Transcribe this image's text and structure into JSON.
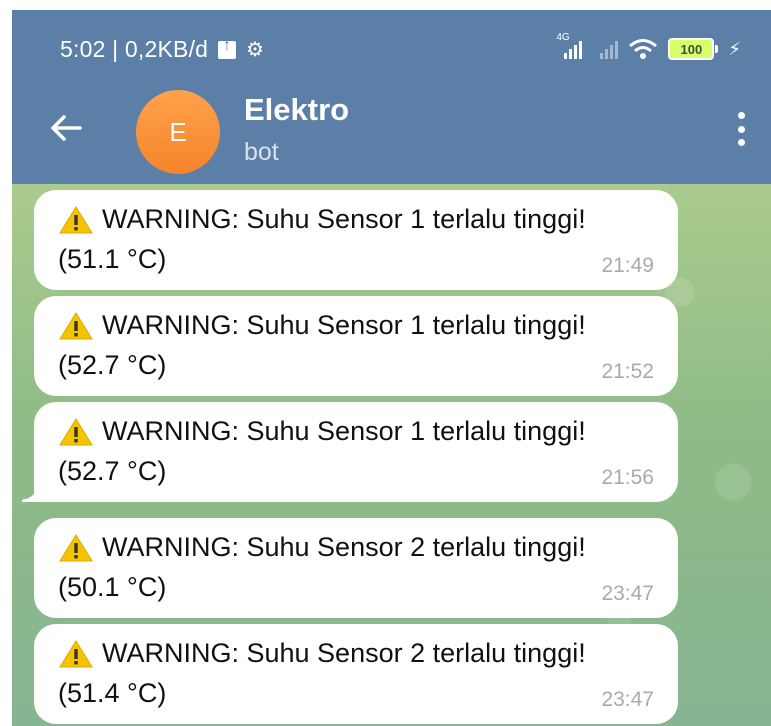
{
  "statusbar": {
    "time_speed": "5:02 | 0,2KB/d",
    "network_label": "4G",
    "battery": "100"
  },
  "header": {
    "title": "Elektro",
    "subtitle": "bot",
    "avatar_letter": "E"
  },
  "messages": [
    {
      "text": "WARNING: Suhu Sensor 1 terlalu tinggi!",
      "value": "(51.1 °C)",
      "time": "21:49"
    },
    {
      "text": "WARNING: Suhu Sensor 1 terlalu tinggi!",
      "value": "(52.7 °C)",
      "time": "21:52"
    },
    {
      "text": "WARNING: Suhu Sensor 1 terlalu tinggi!",
      "value": "(52.7 °C)",
      "time": "21:56"
    },
    {
      "text": "WARNING: Suhu Sensor 2 terlalu tinggi!",
      "value": "(50.1 °C)",
      "time": "23:47"
    },
    {
      "text": "WARNING: Suhu Sensor 2 terlalu tinggi!",
      "value": "(51.4 °C)",
      "time": "23:47"
    }
  ],
  "icons": {
    "warning": "warning-icon",
    "back": "arrow-left-icon",
    "menu": "more-vertical-icon"
  },
  "colors": {
    "header": "#5b7fa6",
    "avatar": "#f4842c",
    "warning": "#f5c400",
    "time": "#a7abae"
  }
}
